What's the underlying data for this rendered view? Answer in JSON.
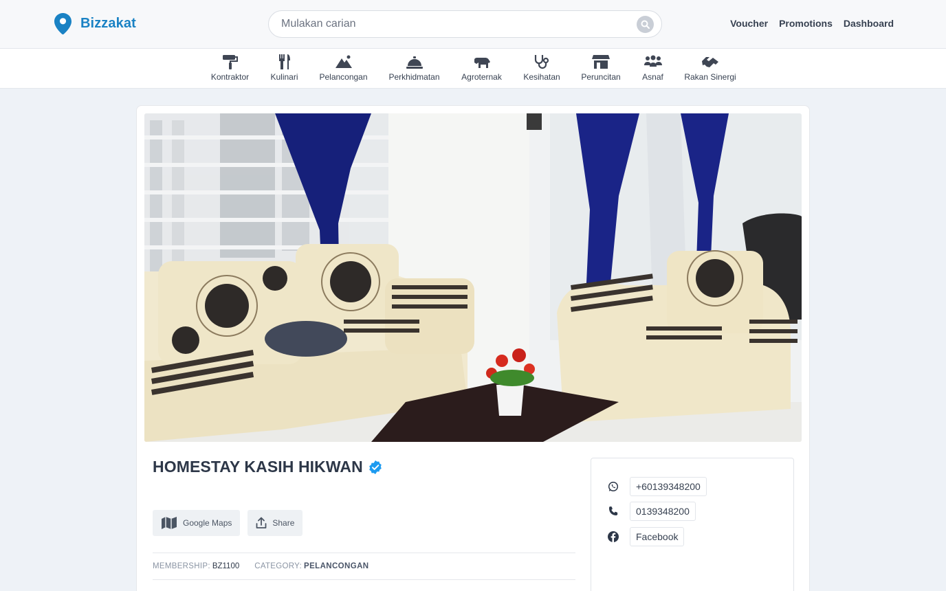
{
  "header": {
    "brand": "Bizzakat",
    "search_placeholder": "Mulakan carian",
    "nav": [
      "Voucher",
      "Promotions",
      "Dashboard"
    ]
  },
  "categories": [
    {
      "label": "Kontraktor",
      "icon": "paint-roller-icon"
    },
    {
      "label": "Kulinari",
      "icon": "utensils-icon"
    },
    {
      "label": "Pelancongan",
      "icon": "mountain-icon"
    },
    {
      "label": "Perkhidmatan",
      "icon": "service-bell-icon"
    },
    {
      "label": "Agroternak",
      "icon": "cow-icon"
    },
    {
      "label": "Kesihatan",
      "icon": "stethoscope-icon"
    },
    {
      "label": "Peruncitan",
      "icon": "store-icon"
    },
    {
      "label": "Asnaf",
      "icon": "people-group-icon"
    },
    {
      "label": "Rakan Sinergi",
      "icon": "handshake-icon"
    }
  ],
  "listing": {
    "title": "HOMESTAY KASIH HIKWAN",
    "verified": true,
    "actions": {
      "maps": "Google Maps",
      "share": "Share"
    },
    "membership_label": "MEMBERSHIP:",
    "membership_value": "BZ1100",
    "category_label": "CATEGORY:",
    "category_value": "PELANCONGAN"
  },
  "contact": {
    "whatsapp": "+60139348200",
    "phone": "0139348200",
    "facebook": "Facebook"
  },
  "colors": {
    "brand": "#1a82c4",
    "verified": "#1d9bf0",
    "icon": "#3f4654"
  }
}
